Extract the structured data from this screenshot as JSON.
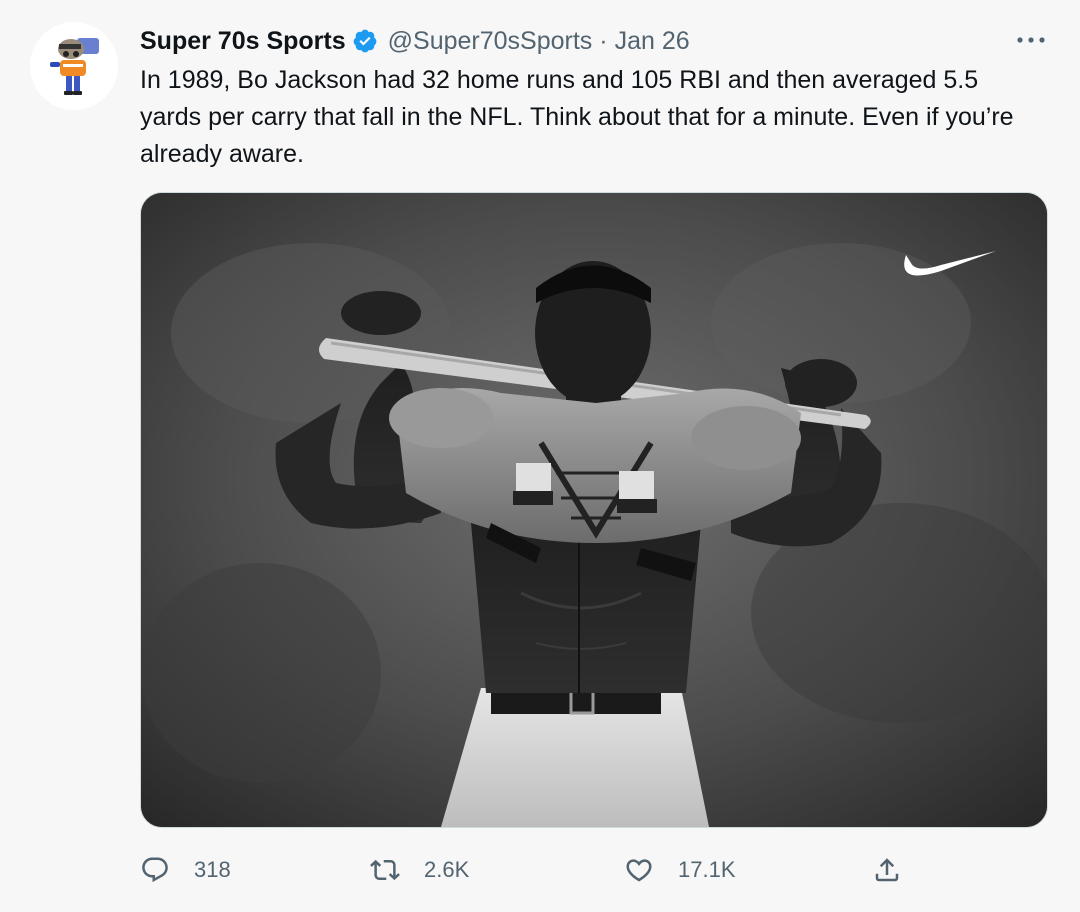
{
  "tweet": {
    "display_name": "Super 70s Sports",
    "handle": "@Super70sSports",
    "separator": "·",
    "date": "Jan 26",
    "text": "In 1989, Bo Jackson had 32 home runs and 105 RBI and then averaged 5.5 yards per carry that fall in the NFL. Think about that for a minute. Even if you’re already aware.",
    "verified": true,
    "avatar_icon": "super-70s-sports-logo",
    "media": {
      "description": "Black-and-white photo of Bo Jackson holding a baseball bat behind his shoulders while wearing football shoulder pads",
      "logo": "nike-swoosh"
    },
    "actions": {
      "reply": {
        "icon": "reply-icon",
        "count": "318"
      },
      "retweet": {
        "icon": "retweet-icon",
        "count": "2.6K"
      },
      "like": {
        "icon": "heart-icon",
        "count": "17.1K"
      },
      "share": {
        "icon": "share-icon"
      }
    }
  },
  "colors": {
    "background": "#f7f7f7",
    "text_primary": "#0f1419",
    "text_secondary": "#536471",
    "verified_blue": "#1d9bf0"
  }
}
